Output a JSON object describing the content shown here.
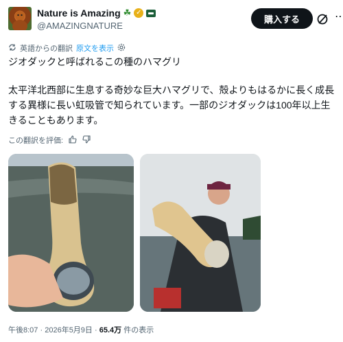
{
  "header": {
    "display_name": "Nature is Amazing",
    "handle": "@AMAZINGNATURE",
    "subscribe_label": "購入する"
  },
  "translation": {
    "note": "英語からの翻訳",
    "show_original": "原文を表示"
  },
  "post": {
    "title": "ジオダックと呼ばれるこの種のハマグリ",
    "body": "太平洋北西部に生息する奇妙な巨大ハマグリで、殻よりもはるかに長く成長する異様に長い虹吸管で知られています。一部のジオダックは100年以上生きることもあります。"
  },
  "rating": {
    "label": "この翻訳を評価:"
  },
  "footer": {
    "time": "午後8:07",
    "date": "2026年5月9日",
    "views": "65.4万",
    "views_suffix": "件の表示"
  },
  "colors": {
    "accent": "#1d9bf0",
    "text": "#0f1419",
    "muted": "#536471"
  }
}
